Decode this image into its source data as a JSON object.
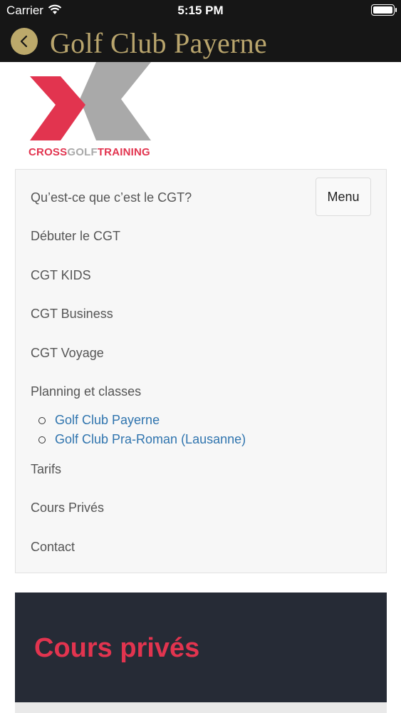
{
  "status_bar": {
    "carrier": "Carrier",
    "time": "5:15 PM"
  },
  "nav_bar": {
    "title": "Golf Club Payerne"
  },
  "logo": {
    "text_part1": "CROSS",
    "text_part2": "GOLF",
    "text_part3": "TRAINING"
  },
  "menu": {
    "toggle_label": "Menu",
    "items": [
      "Qu’est-ce que c’est le CGT?",
      "Débuter le CGT",
      "CGT KIDS",
      "CGT Business",
      "CGT Voyage",
      "Planning et classes"
    ],
    "sub_items": [
      "Golf Club Payerne",
      "Golf Club Pra-Roman (Lausanne)"
    ],
    "after_items": [
      "Tarifs",
      "Cours Privés",
      "Contact"
    ]
  },
  "hero": {
    "title": "Cours privés"
  },
  "colors": {
    "accent_red": "#e2344f",
    "gold": "#b9a56d",
    "link_blue": "#2f74ae",
    "dark": "#161616"
  }
}
